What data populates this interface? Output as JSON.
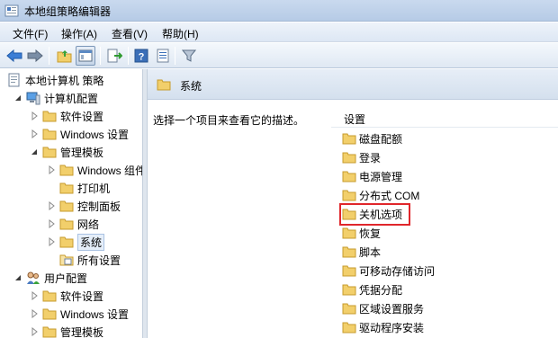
{
  "window": {
    "title": "本地组策略编辑器"
  },
  "menu": [
    "文件(F)",
    "操作(A)",
    "查看(V)",
    "帮助(H)"
  ],
  "toolbar": {
    "buttons": [
      "back-arrow-icon",
      "forward-arrow-icon",
      "up-folder-icon",
      "show-hide-tree-icon",
      "export-list-icon",
      "help-icon",
      "details-icon",
      "filter-icon"
    ]
  },
  "tree": {
    "root": "本地计算机 策略",
    "computer_config": "计算机配置",
    "software_settings": "软件设置",
    "windows_settings": "Windows 设置",
    "admin_templates": "管理模板",
    "windows_components": "Windows 组件",
    "printers": "打印机",
    "control_panel": "控制面板",
    "network": "网络",
    "system": "系统",
    "all_settings": "所有设置",
    "user_config": "用户配置",
    "user_software_settings": "软件设置",
    "user_windows_settings": "Windows 设置",
    "user_admin_templates": "管理模板"
  },
  "right": {
    "header_title": "系统",
    "description": "选择一个项目来查看它的描述。",
    "column_header": "设置",
    "items": [
      "磁盘配额",
      "登录",
      "电源管理",
      "分布式 COM",
      "关机选项",
      "恢复",
      "脚本",
      "可移动存储访问",
      "凭据分配",
      "区域设置服务",
      "驱动程序安装"
    ],
    "highlighted_item": "关机选项"
  },
  "colors": {
    "folder": "#f2cf6b",
    "highlight": "#e0262b",
    "selection": "#e5eef9"
  }
}
